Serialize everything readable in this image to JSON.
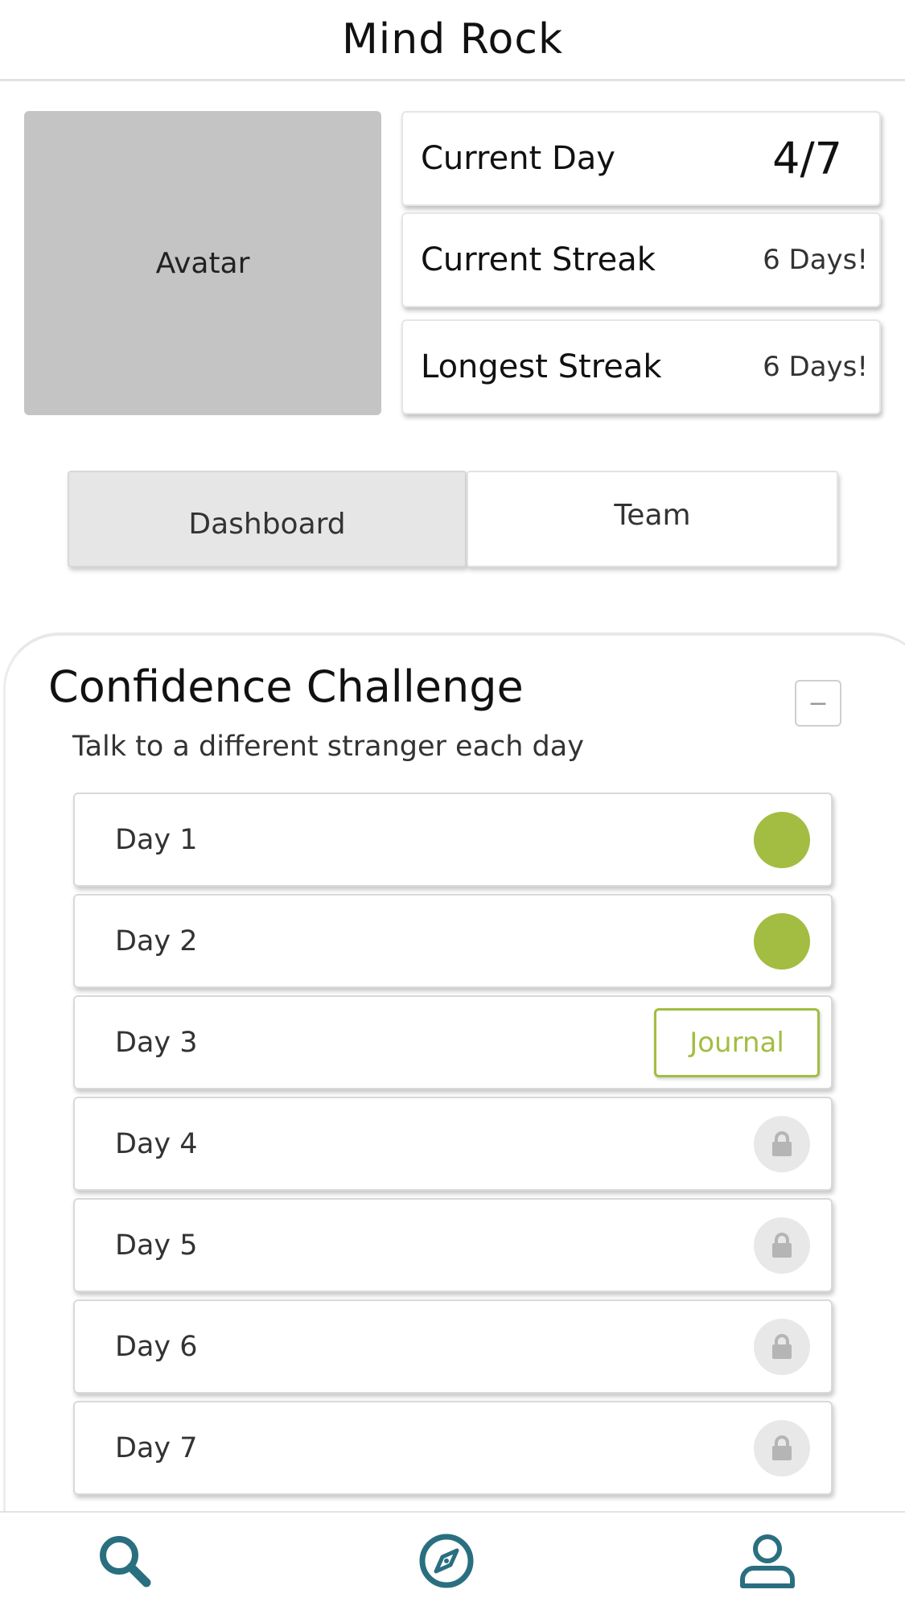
{
  "app": {
    "title": "Mind Rock"
  },
  "profile": {
    "avatar_label": "Avatar",
    "stats": [
      {
        "label": "Current Day",
        "value": "4/7"
      },
      {
        "label": "Current Streak",
        "value": "6 Days!"
      },
      {
        "label": "Longest Streak",
        "value": "6 Days!"
      }
    ]
  },
  "tabs": [
    {
      "label": "Dashboard",
      "active": true
    },
    {
      "label": "Team",
      "active": false
    }
  ],
  "challenge": {
    "title": "Confidence Challenge",
    "collapse_symbol": "−",
    "subtitle": "Talk to a different stranger each day",
    "journal_label": "Journal",
    "days": [
      {
        "label": "Day 1",
        "status": "completed"
      },
      {
        "label": "Day 2",
        "status": "completed"
      },
      {
        "label": "Day 3",
        "status": "current"
      },
      {
        "label": "Day 4",
        "status": "locked"
      },
      {
        "label": "Day 5",
        "status": "locked"
      },
      {
        "label": "Day 6",
        "status": "locked"
      },
      {
        "label": "Day 7",
        "status": "locked"
      }
    ]
  },
  "nav": {
    "icons": [
      "search-icon",
      "compass-icon",
      "profile-icon"
    ]
  },
  "colors": {
    "accent": "#a2bd41",
    "nav_icon": "#2a6f80",
    "locked_bg": "#e8e8e8"
  }
}
